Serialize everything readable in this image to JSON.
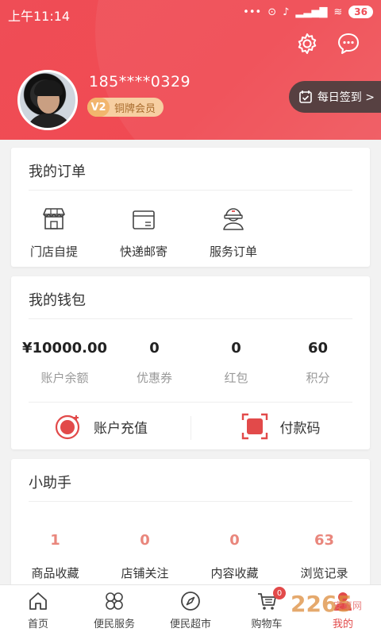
{
  "status_bar": {
    "time": "上午11:14",
    "battery": "36"
  },
  "profile": {
    "phone": "185****0329",
    "level": "V2",
    "member_label": "铜牌会员",
    "signin_label": "每日签到 >"
  },
  "orders": {
    "title": "我的订单",
    "items": [
      {
        "label": "门店自提",
        "icon": "store-icon"
      },
      {
        "label": "快递邮寄",
        "icon": "package-icon"
      },
      {
        "label": "服务订单",
        "icon": "service-icon"
      }
    ]
  },
  "wallet": {
    "title": "我的钱包",
    "stats": [
      {
        "value": "¥10000.00",
        "label": "账户余额"
      },
      {
        "value": "0",
        "label": "优惠券"
      },
      {
        "value": "0",
        "label": "红包"
      },
      {
        "value": "60",
        "label": "积分"
      }
    ],
    "recharge_label": "账户充值",
    "paycode_label": "付款码"
  },
  "helper": {
    "title": "小助手",
    "stats": [
      {
        "value": "1",
        "label": "商品收藏"
      },
      {
        "value": "0",
        "label": "店铺关注"
      },
      {
        "value": "0",
        "label": "内容收藏"
      },
      {
        "value": "63",
        "label": "浏览记录"
      }
    ]
  },
  "tabbar": {
    "items": [
      {
        "label": "首页",
        "icon": "home-icon"
      },
      {
        "label": "便民服务",
        "icon": "grid-icon"
      },
      {
        "label": "便民超市",
        "icon": "compass-icon"
      },
      {
        "label": "购物车",
        "icon": "cart-icon"
      },
      {
        "label": "我的",
        "icon": "user-icon",
        "active": true
      }
    ],
    "cart_badge": "0"
  },
  "watermark": {
    "text": "2265",
    "subtext": "安卓网"
  },
  "colors": {
    "brand": "#ef4d56",
    "accent_red": "#e24a4a",
    "helper_number": "#e9867c"
  }
}
